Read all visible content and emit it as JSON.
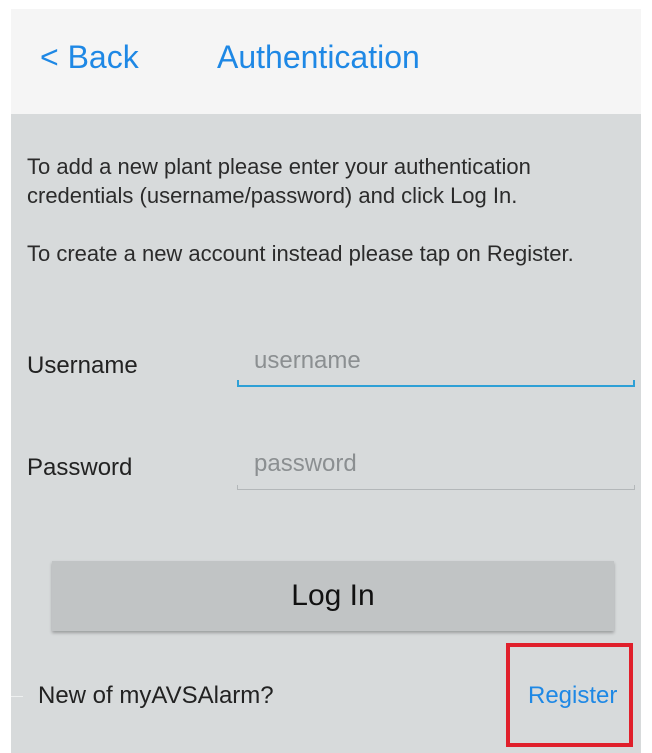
{
  "header": {
    "back_label": "< Back",
    "title": "Authentication"
  },
  "instructions": {
    "login_text": "To add a new plant please enter your authentication credentials (username/password) and click Log In.",
    "register_text": "To create a new account instead please tap on Register."
  },
  "form": {
    "username_label": "Username",
    "username_placeholder": "username",
    "username_value": "",
    "password_label": "Password",
    "password_placeholder": "password",
    "password_value": "",
    "login_button": "Log In"
  },
  "footer": {
    "new_user_text": "New of myAVSAlarm?",
    "register_link": "Register"
  },
  "colors": {
    "accent": "#1e88e5",
    "focus_underline": "#2ea0d6",
    "header_bg": "#f5f5f5",
    "content_bg": "#d7dadb",
    "button_bg": "#c1c4c5",
    "highlight_box": "#e01f2b"
  }
}
